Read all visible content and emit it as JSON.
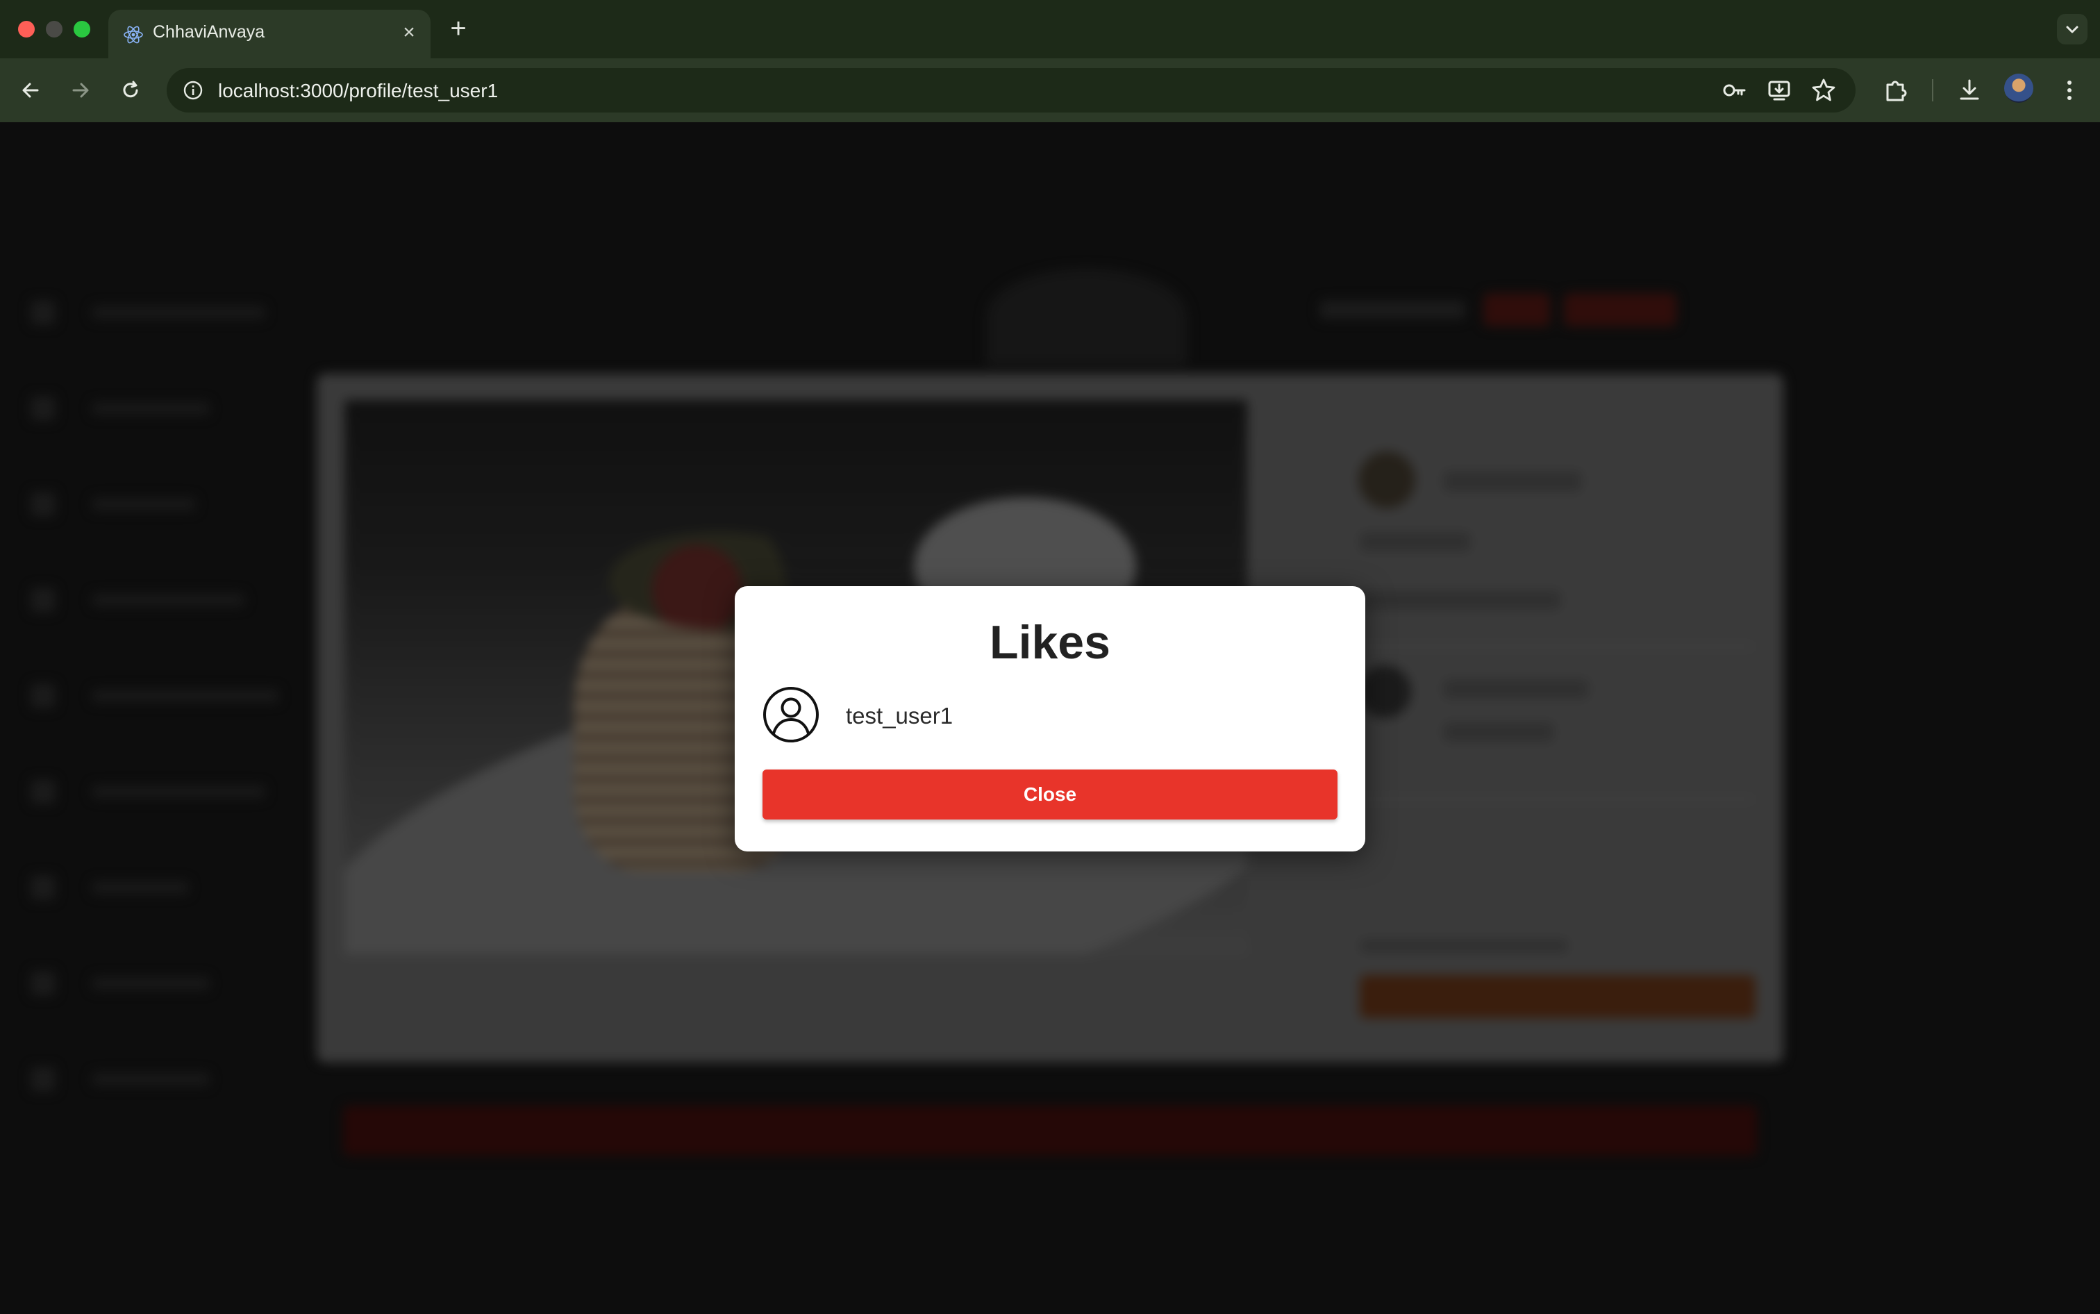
{
  "browser": {
    "tab_title": "ChhaviAnvaya",
    "url_host": "localhost",
    "url_path": ":3000/profile/test_user1"
  },
  "likes_dialog": {
    "title": "Likes",
    "users": [
      {
        "username": "test_user1"
      }
    ],
    "close_label": "Close"
  },
  "colors": {
    "close_button": "#e8342a",
    "browser_frame": "#2c3a27",
    "overlay": "#000000"
  }
}
